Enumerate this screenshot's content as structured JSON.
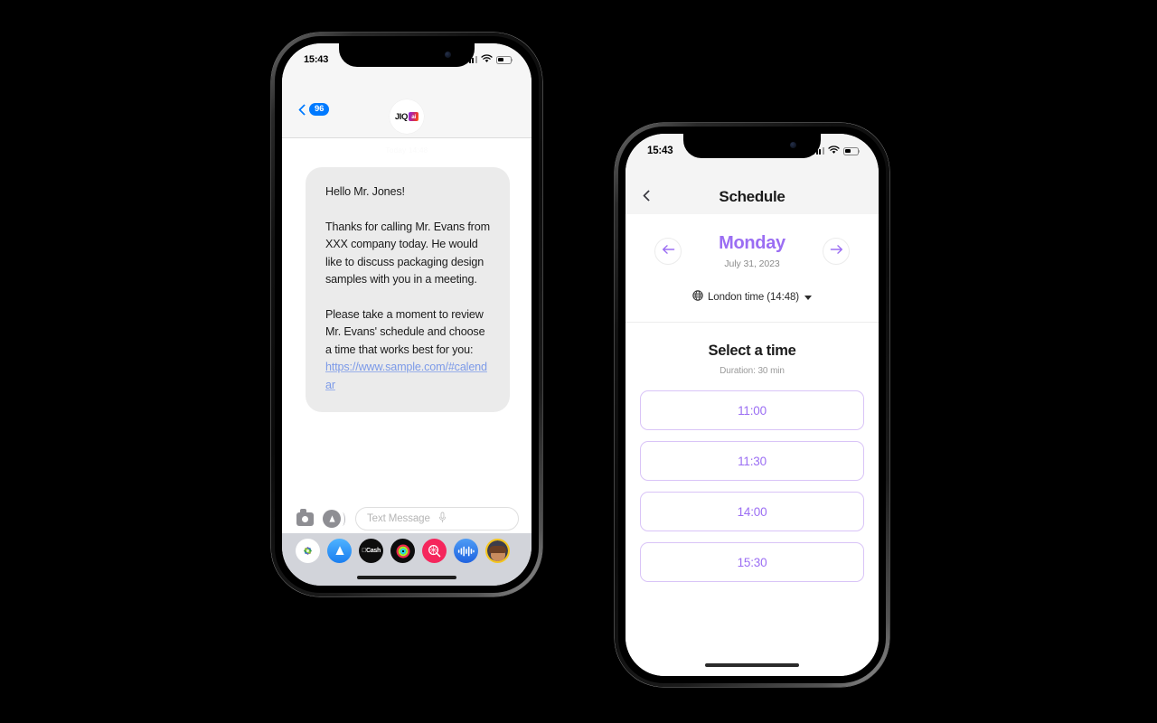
{
  "theme": {
    "accent_purple": "#9b6ef3",
    "slot_border": "#d9c4f7",
    "ios_blue": "#007aff",
    "bubble_gray": "#ebebeb",
    "link_blue": "#7c9ae8"
  },
  "messages_phone": {
    "status_bar": {
      "time": "15:43",
      "signal_icon": "cellular-bars-icon",
      "wifi_icon": "wifi-icon",
      "battery_icon": "battery-icon"
    },
    "header": {
      "back_icon": "chevron-left-icon",
      "unread_badge": "96",
      "contact_logo": {
        "name": "JIQ",
        "badge": "ai"
      }
    },
    "conversation": {
      "timestamp": "Today 14:48",
      "bubble": {
        "greeting": "Hello Mr. Jones!",
        "paragraph1": "Thanks for calling Mr. Evans from XXX company today. He would like to discuss packaging design samples with you in a meeting.",
        "paragraph2": "Please take a moment to review Mr. Evans' schedule and choose a time that works best for you:",
        "link_text": "https://www.sample.com/#calendar"
      }
    },
    "input_bar": {
      "camera_icon": "camera-icon",
      "appstore_icon": "app-store-icon",
      "placeholder": "Text Message",
      "mic_icon": "microphone-icon"
    },
    "dock": [
      {
        "name": "photos-app-icon",
        "label": "Photos"
      },
      {
        "name": "app-store-app-icon",
        "label": "App Store"
      },
      {
        "name": "apple-cash-app-icon",
        "label": "Cash"
      },
      {
        "name": "fitness-app-icon",
        "label": "Fitness"
      },
      {
        "name": "music-search-app-icon",
        "label": "Music Search"
      },
      {
        "name": "voice-memos-app-icon",
        "label": "Voice Memos"
      },
      {
        "name": "memoji-app-icon",
        "label": "Memoji"
      }
    ]
  },
  "schedule_phone": {
    "status_bar": {
      "time": "15:43",
      "signal_icon": "cellular-bars-icon",
      "wifi_icon": "wifi-icon",
      "battery_icon": "battery-icon"
    },
    "header": {
      "back_icon": "chevron-left-icon",
      "title": "Schedule"
    },
    "day_nav": {
      "prev_icon": "arrow-left-icon",
      "next_icon": "arrow-right-icon",
      "day_name": "Monday",
      "date": "July 31, 2023"
    },
    "timezone": {
      "globe_icon": "globe-icon",
      "label": "London time (14:48)",
      "caret_icon": "caret-down-icon"
    },
    "select_time": {
      "title": "Select a time",
      "duration": "Duration: 30 min",
      "slots": [
        "11:00",
        "11:30",
        "14:00",
        "15:30"
      ]
    }
  }
}
